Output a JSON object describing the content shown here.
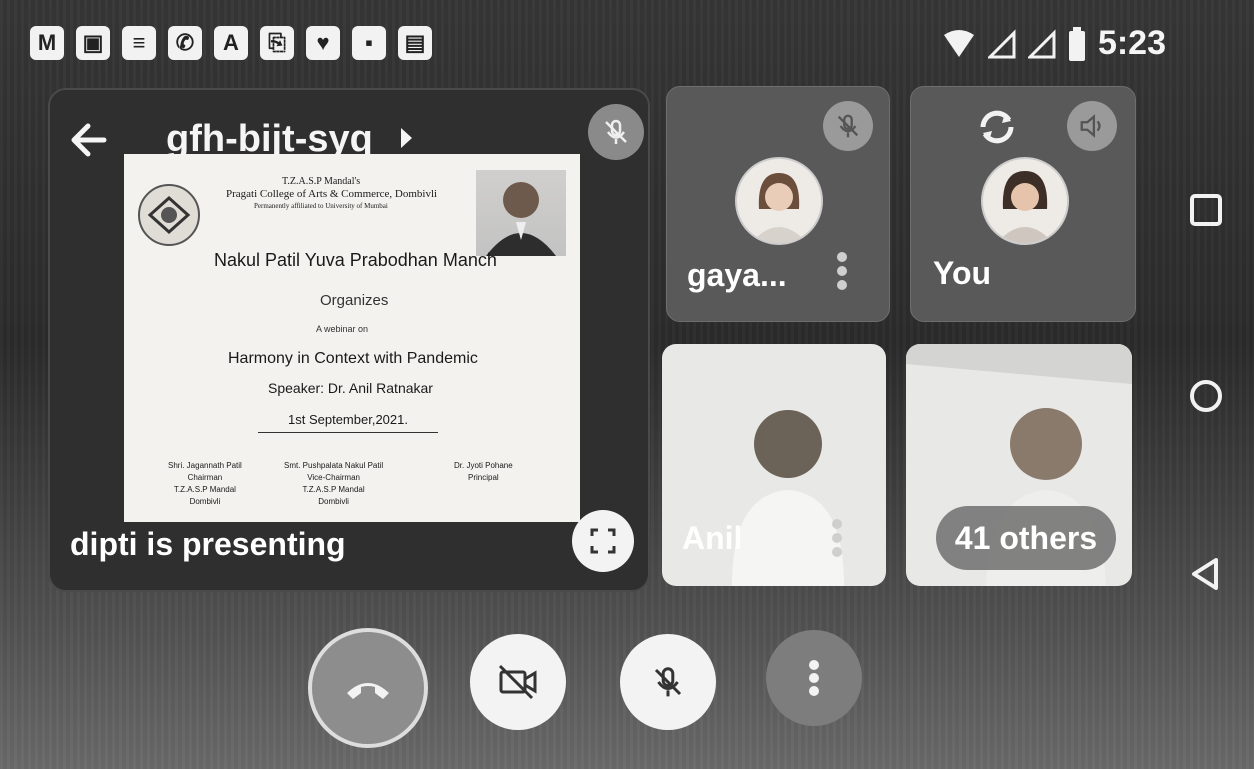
{
  "status_bar": {
    "app_icons": [
      "M",
      "▣",
      "≡",
      "✆",
      "A",
      "⎘",
      "♥",
      "▪",
      "▤"
    ],
    "time": "5:23"
  },
  "meeting": {
    "code": "gfh-bijt-syq",
    "presenting_label": "dipti is presenting"
  },
  "slide": {
    "org_line1": "T.Z.A.S.P Mandal's",
    "org_line2": "Pragati College of Arts & Commerce, Dombivli",
    "org_line3": "Permanently affiliated to University of Mumbai",
    "manch": "Nakul Patil Yuva Prabodhan Manch",
    "organizes": "Organizes",
    "webinar": "A webinar on",
    "topic": "Harmony in Context with Pandemic",
    "speaker": "Speaker: Dr. Anil Ratnakar",
    "date": "1st September,2021.",
    "signatories": [
      {
        "name": "Shri. Jagannath Patil",
        "role": "Chairman",
        "org": "T.Z.A.S.P Mandal",
        "place": "Dombivli"
      },
      {
        "name": "Smt. Pushpalata Nakul Patil",
        "role": "Vice-Chairman",
        "org": "T.Z.A.S.P Mandal",
        "place": "Dombivli"
      },
      {
        "name": "Dr. Jyoti Pohane",
        "role": "Principal",
        "org": "",
        "place": ""
      }
    ]
  },
  "participants": [
    {
      "name": "gaya...",
      "muted": true
    },
    {
      "name": "You",
      "muted": false
    },
    {
      "name": "Anil",
      "muted": true
    },
    {
      "name": "41 others",
      "muted": false
    }
  ],
  "controls": {
    "end_call": "end-call",
    "camera": "camera-off",
    "mic": "mic-off",
    "more": "more-options"
  },
  "colors": {
    "end_call_bg": "#8d8d8d",
    "button_bg": "#f3f3f3",
    "more_bg": "#7d7d7d"
  }
}
